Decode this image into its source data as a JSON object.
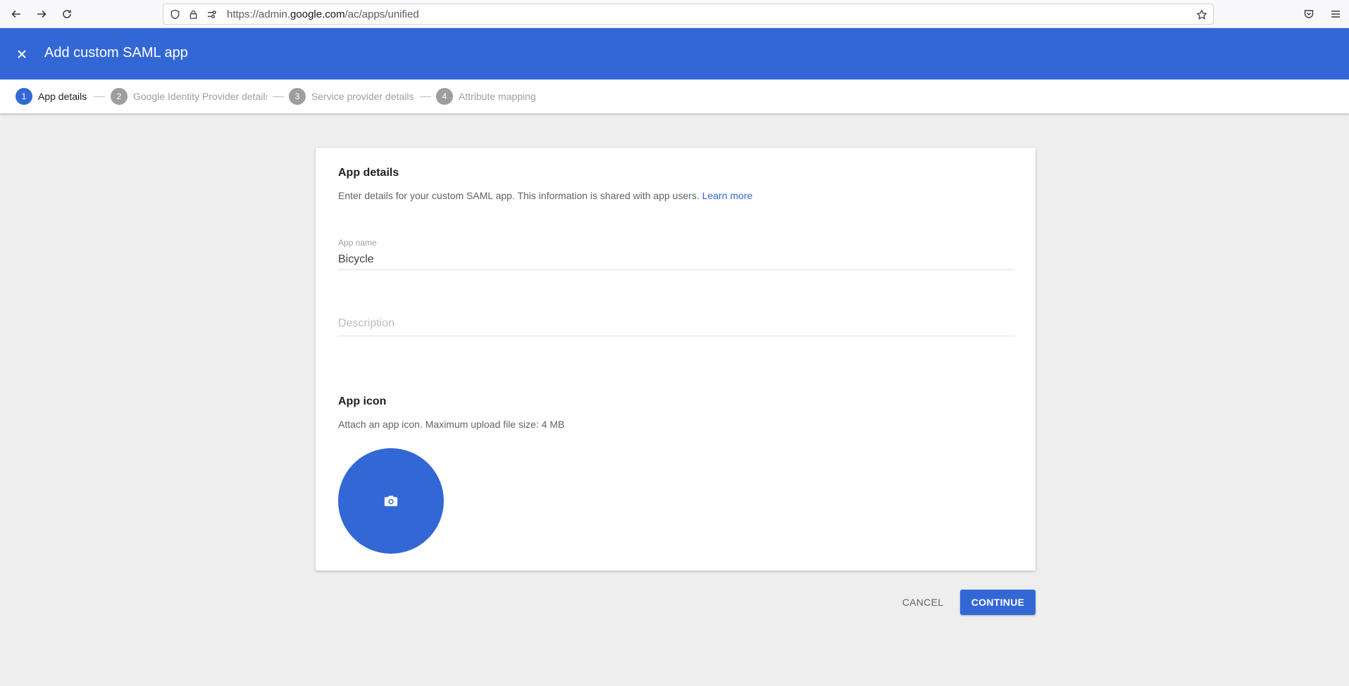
{
  "browser": {
    "url_prefix": "https://admin.",
    "url_domain": "google.com",
    "url_path": "/ac/apps/unified",
    "icons": [
      "back-arrow-icon",
      "forward-arrow-icon",
      "reload-icon",
      "shield-icon",
      "lock-icon",
      "permissions-icon",
      "bookmark-star-icon",
      "pocket-icon",
      "menu-icon"
    ]
  },
  "header": {
    "title": "Add custom SAML app",
    "close_icon": "close-icon",
    "background": "#3367d6"
  },
  "stepper": {
    "steps": [
      {
        "number": "1",
        "label": "App details",
        "active": true
      },
      {
        "number": "2",
        "label": "Google Identity Provider details",
        "active": false
      },
      {
        "number": "3",
        "label": "Service provider details",
        "active": false
      },
      {
        "number": "4",
        "label": "Attribute mapping",
        "active": false
      }
    ]
  },
  "card": {
    "title": "App details",
    "description": "Enter details for your custom SAML app. This information is shared with app users.",
    "learn_more": "Learn more",
    "app_name_label": "App name",
    "app_name_value": "Bicycle",
    "description_placeholder": "Description",
    "icon_section_title": "App icon",
    "icon_section_desc": "Attach an app icon. Maximum upload file size: 4 MB",
    "upload_icon": "camera-icon"
  },
  "actions": {
    "cancel": "CANCEL",
    "continue": "CONTINUE"
  },
  "colors": {
    "accent": "#3367d6",
    "page_background": "#eeeeee"
  }
}
